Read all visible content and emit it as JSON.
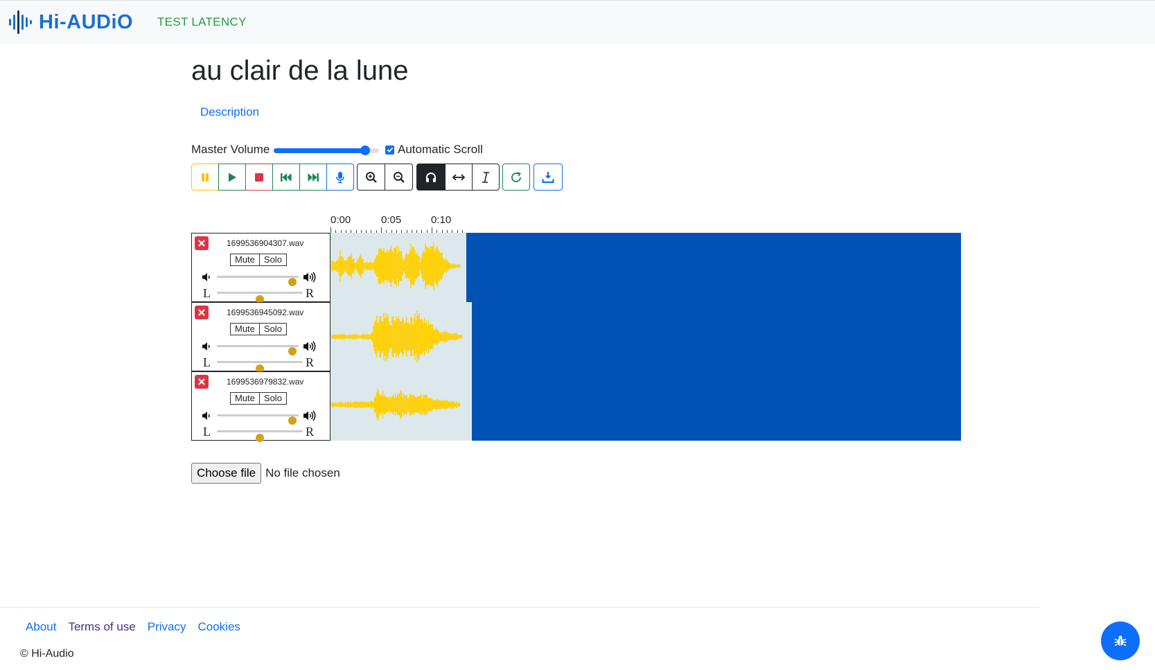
{
  "navbar": {
    "logo_text": "Hi-AUDiO",
    "test_latency_link": "TEST LATENCY"
  },
  "page": {
    "title": "au clair de la lune",
    "tabs": [
      {
        "label": "Description"
      }
    ]
  },
  "controls": {
    "master_volume_label": "Master Volume",
    "master_volume_value": 0.87,
    "automatic_scroll_label": "Automatic Scroll",
    "automatic_scroll_checked": true
  },
  "toolbar": {
    "buttons": [
      {
        "name": "pause-icon",
        "color": "#ffc107"
      },
      {
        "name": "play-icon",
        "color": "#198754"
      },
      {
        "name": "stop-icon",
        "color": "#dc3545"
      },
      {
        "name": "skip-back-icon",
        "color": "#198754"
      },
      {
        "name": "skip-forward-icon",
        "color": "#198754"
      },
      {
        "name": "microphone-icon",
        "color": "#0d6efd"
      },
      {
        "name": "zoom-in-icon",
        "color": "#212529"
      },
      {
        "name": "zoom-out-icon",
        "color": "#212529"
      },
      {
        "name": "headphones-icon",
        "color": "#212529",
        "active": true
      },
      {
        "name": "horizontal-arrows-icon",
        "color": "#212529"
      },
      {
        "name": "text-cursor-icon",
        "color": "#212529"
      },
      {
        "name": "refresh-icon",
        "color": "#198754"
      },
      {
        "name": "download-icon",
        "color": "#0d6efd"
      }
    ]
  },
  "timeline": {
    "ruler_labels": [
      "0:00",
      "0:05",
      "0:10"
    ]
  },
  "tracks": [
    {
      "filename": "1699536904307.wav",
      "mute_label": "Mute",
      "solo_label": "Solo",
      "volume": 0.92,
      "pan": 0.5,
      "pan_left_label": "L",
      "pan_right_label": "R"
    },
    {
      "filename": "1699536945092.wav",
      "mute_label": "Mute",
      "solo_label": "Solo",
      "volume": 0.92,
      "pan": 0.5,
      "pan_left_label": "L",
      "pan_right_label": "R"
    },
    {
      "filename": "1699536979832.wav",
      "mute_label": "Mute",
      "solo_label": "Solo",
      "volume": 0.92,
      "pan": 0.5,
      "pan_left_label": "L",
      "pan_right_label": "R"
    }
  ],
  "colors": {
    "waveform": "#ffd000",
    "track_background": "#dce8ec",
    "empty_area": "#0152b4"
  },
  "file_input": {
    "button_label": "Choose file",
    "status": "No file chosen"
  },
  "footer": {
    "links": [
      {
        "label": "About"
      },
      {
        "label": "Terms of use"
      },
      {
        "label": "Privacy"
      },
      {
        "label": "Cookies"
      }
    ],
    "copyright": "© Hi-Audio"
  },
  "fab": {
    "icon": "bug-icon"
  }
}
